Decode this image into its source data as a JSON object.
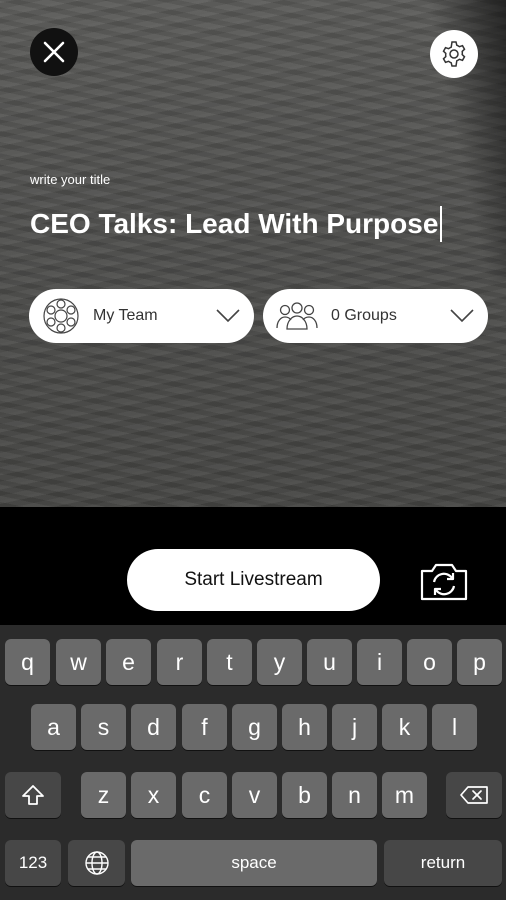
{
  "header": {
    "close_icon": "close-icon",
    "settings_icon": "gear-icon"
  },
  "title_field": {
    "label": "write your title",
    "value": "CEO Talks: Lead With Purpose"
  },
  "selectors": {
    "team": {
      "label": "My Team",
      "icon": "team-icon"
    },
    "groups": {
      "label": "0 Groups",
      "icon": "groups-icon"
    }
  },
  "actions": {
    "start_label": "Start Livestream",
    "flip_icon": "camera-flip-icon"
  },
  "keyboard": {
    "row1": [
      "q",
      "w",
      "e",
      "r",
      "t",
      "y",
      "u",
      "i",
      "o",
      "p"
    ],
    "row2": [
      "a",
      "s",
      "d",
      "f",
      "g",
      "h",
      "j",
      "k",
      "l"
    ],
    "row3": [
      "z",
      "x",
      "c",
      "v",
      "b",
      "n",
      "m"
    ],
    "numbers_label": "123",
    "space_label": "space",
    "return_label": "return"
  },
  "colors": {
    "accent": "#ffffff",
    "key": "#6a6a6a",
    "key_dark": "#474747",
    "keyboard_bg": "#2b2b2b"
  }
}
